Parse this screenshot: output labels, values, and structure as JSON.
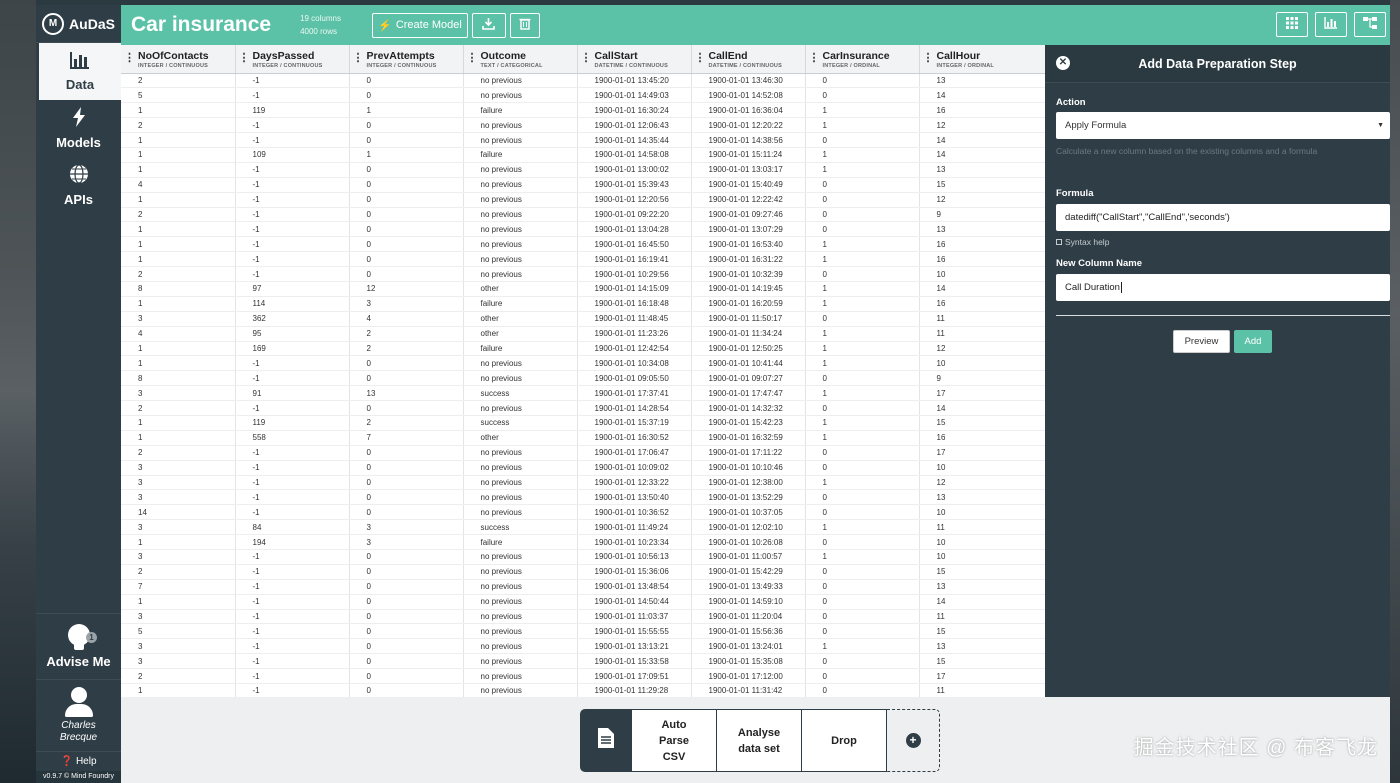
{
  "brand": {
    "logo": "M",
    "name": "AuDaS"
  },
  "nav": [
    {
      "label": "Data",
      "icon": "bar-chart-icon"
    },
    {
      "label": "Models",
      "icon": "lightning-icon"
    },
    {
      "label": "APIs",
      "icon": "globe-icon"
    }
  ],
  "advise": {
    "label": "Advise Me",
    "badge": "1"
  },
  "user": {
    "first": "Charles",
    "last": "Brecque"
  },
  "help": {
    "label": "Help"
  },
  "version": "v0.9.7 © Mind Foundry",
  "header": {
    "title": "Car insurance",
    "columns_meta": "19 columns",
    "rows_meta": "4000 rows",
    "create_model": "Create Model"
  },
  "table": {
    "columns": [
      {
        "name": "NoOfContacts",
        "type": "INTEGER / CONTINUOUS"
      },
      {
        "name": "DaysPassed",
        "type": "INTEGER / CONTINUOUS"
      },
      {
        "name": "PrevAttempts",
        "type": "INTEGER / CONTINUOUS"
      },
      {
        "name": "Outcome",
        "type": "TEXT / CATEGORICAL"
      },
      {
        "name": "CallStart",
        "type": "DATETIME / CONTINUOUS"
      },
      {
        "name": "CallEnd",
        "type": "DATETIME / CONTINUOUS"
      },
      {
        "name": "CarInsurance",
        "type": "INTEGER / ORDINAL"
      },
      {
        "name": "CallHour",
        "type": "INTEGER / ORDINAL"
      }
    ],
    "rows": [
      [
        "2",
        "-1",
        "0",
        "no previous",
        "1900-01-01 13:45:20",
        "1900-01-01 13:46:30",
        "0",
        "13"
      ],
      [
        "5",
        "-1",
        "0",
        "no previous",
        "1900-01-01 14:49:03",
        "1900-01-01 14:52:08",
        "0",
        "14"
      ],
      [
        "1",
        "119",
        "1",
        "failure",
        "1900-01-01 16:30:24",
        "1900-01-01 16:36:04",
        "1",
        "16"
      ],
      [
        "2",
        "-1",
        "0",
        "no previous",
        "1900-01-01 12:06:43",
        "1900-01-01 12:20:22",
        "1",
        "12"
      ],
      [
        "1",
        "-1",
        "0",
        "no previous",
        "1900-01-01 14:35:44",
        "1900-01-01 14:38:56",
        "0",
        "14"
      ],
      [
        "1",
        "109",
        "1",
        "failure",
        "1900-01-01 14:58:08",
        "1900-01-01 15:11:24",
        "1",
        "14"
      ],
      [
        "1",
        "-1",
        "0",
        "no previous",
        "1900-01-01 13:00:02",
        "1900-01-01 13:03:17",
        "1",
        "13"
      ],
      [
        "4",
        "-1",
        "0",
        "no previous",
        "1900-01-01 15:39:43",
        "1900-01-01 15:40:49",
        "0",
        "15"
      ],
      [
        "1",
        "-1",
        "0",
        "no previous",
        "1900-01-01 12:20:56",
        "1900-01-01 12:22:42",
        "0",
        "12"
      ],
      [
        "2",
        "-1",
        "0",
        "no previous",
        "1900-01-01 09:22:20",
        "1900-01-01 09:27:46",
        "0",
        "9"
      ],
      [
        "1",
        "-1",
        "0",
        "no previous",
        "1900-01-01 13:04:28",
        "1900-01-01 13:07:29",
        "0",
        "13"
      ],
      [
        "1",
        "-1",
        "0",
        "no previous",
        "1900-01-01 16:45:50",
        "1900-01-01 16:53:40",
        "1",
        "16"
      ],
      [
        "1",
        "-1",
        "0",
        "no previous",
        "1900-01-01 16:19:41",
        "1900-01-01 16:31:22",
        "1",
        "16"
      ],
      [
        "2",
        "-1",
        "0",
        "no previous",
        "1900-01-01 10:29:56",
        "1900-01-01 10:32:39",
        "0",
        "10"
      ],
      [
        "8",
        "97",
        "12",
        "other",
        "1900-01-01 14:15:09",
        "1900-01-01 14:19:45",
        "1",
        "14"
      ],
      [
        "1",
        "114",
        "3",
        "failure",
        "1900-01-01 16:18:48",
        "1900-01-01 16:20:59",
        "1",
        "16"
      ],
      [
        "3",
        "362",
        "4",
        "other",
        "1900-01-01 11:48:45",
        "1900-01-01 11:50:17",
        "0",
        "11"
      ],
      [
        "4",
        "95",
        "2",
        "other",
        "1900-01-01 11:23:26",
        "1900-01-01 11:34:24",
        "1",
        "11"
      ],
      [
        "1",
        "169",
        "2",
        "failure",
        "1900-01-01 12:42:54",
        "1900-01-01 12:50:25",
        "1",
        "12"
      ],
      [
        "1",
        "-1",
        "0",
        "no previous",
        "1900-01-01 10:34:08",
        "1900-01-01 10:41:44",
        "1",
        "10"
      ],
      [
        "8",
        "-1",
        "0",
        "no previous",
        "1900-01-01 09:05:50",
        "1900-01-01 09:07:27",
        "0",
        "9"
      ],
      [
        "3",
        "91",
        "13",
        "success",
        "1900-01-01 17:37:41",
        "1900-01-01 17:47:47",
        "1",
        "17"
      ],
      [
        "2",
        "-1",
        "0",
        "no previous",
        "1900-01-01 14:28:54",
        "1900-01-01 14:32:32",
        "0",
        "14"
      ],
      [
        "1",
        "119",
        "2",
        "success",
        "1900-01-01 15:37:19",
        "1900-01-01 15:42:23",
        "1",
        "15"
      ],
      [
        "1",
        "558",
        "7",
        "other",
        "1900-01-01 16:30:52",
        "1900-01-01 16:32:59",
        "1",
        "16"
      ],
      [
        "2",
        "-1",
        "0",
        "no previous",
        "1900-01-01 17:06:47",
        "1900-01-01 17:11:22",
        "0",
        "17"
      ],
      [
        "3",
        "-1",
        "0",
        "no previous",
        "1900-01-01 10:09:02",
        "1900-01-01 10:10:46",
        "0",
        "10"
      ],
      [
        "3",
        "-1",
        "0",
        "no previous",
        "1900-01-01 12:33:22",
        "1900-01-01 12:38:00",
        "1",
        "12"
      ],
      [
        "3",
        "-1",
        "0",
        "no previous",
        "1900-01-01 13:50:40",
        "1900-01-01 13:52:29",
        "0",
        "13"
      ],
      [
        "14",
        "-1",
        "0",
        "no previous",
        "1900-01-01 10:36:52",
        "1900-01-01 10:37:05",
        "0",
        "10"
      ],
      [
        "3",
        "84",
        "3",
        "success",
        "1900-01-01 11:49:24",
        "1900-01-01 12:02:10",
        "1",
        "11"
      ],
      [
        "1",
        "194",
        "3",
        "failure",
        "1900-01-01 10:23:34",
        "1900-01-01 10:26:08",
        "0",
        "10"
      ],
      [
        "3",
        "-1",
        "0",
        "no previous",
        "1900-01-01 10:56:13",
        "1900-01-01 11:00:57",
        "1",
        "10"
      ],
      [
        "2",
        "-1",
        "0",
        "no previous",
        "1900-01-01 15:36:06",
        "1900-01-01 15:42:29",
        "0",
        "15"
      ],
      [
        "7",
        "-1",
        "0",
        "no previous",
        "1900-01-01 13:48:54",
        "1900-01-01 13:49:33",
        "0",
        "13"
      ],
      [
        "1",
        "-1",
        "0",
        "no previous",
        "1900-01-01 14:50:44",
        "1900-01-01 14:59:10",
        "0",
        "14"
      ],
      [
        "3",
        "-1",
        "0",
        "no previous",
        "1900-01-01 11:03:37",
        "1900-01-01 11:20:04",
        "0",
        "11"
      ],
      [
        "5",
        "-1",
        "0",
        "no previous",
        "1900-01-01 15:55:55",
        "1900-01-01 15:56:36",
        "0",
        "15"
      ],
      [
        "3",
        "-1",
        "0",
        "no previous",
        "1900-01-01 13:13:21",
        "1900-01-01 13:24:01",
        "1",
        "13"
      ],
      [
        "3",
        "-1",
        "0",
        "no previous",
        "1900-01-01 15:33:58",
        "1900-01-01 15:35:08",
        "0",
        "15"
      ],
      [
        "2",
        "-1",
        "0",
        "no previous",
        "1900-01-01 17:09:51",
        "1900-01-01 17:12:00",
        "0",
        "17"
      ],
      [
        "1",
        "-1",
        "0",
        "no previous",
        "1900-01-01 11:29:28",
        "1900-01-01 11:31:42",
        "0",
        "11"
      ]
    ]
  },
  "panel": {
    "title": "Add Data Preparation Step",
    "action_label": "Action",
    "action_value": "Apply Formula",
    "action_hint": "Calculate a new column based on the existing columns and a formula",
    "formula_label": "Formula",
    "formula_value": "datediff(\"CallStart\",\"CallEnd\",'seconds')",
    "syntax_help": "Syntax help",
    "new_column_label": "New Column Name",
    "new_column_value": "Call Duration",
    "preview": "Preview",
    "add": "Add"
  },
  "pipeline": [
    {
      "label": "Auto Parse CSV"
    },
    {
      "label": "Analyse data set"
    },
    {
      "label": "Drop"
    }
  ],
  "watermark": "掘金技术社区 @ 布客飞龙",
  "colors": {
    "accent": "#5cc2a7",
    "dark": "#2f3e46"
  }
}
